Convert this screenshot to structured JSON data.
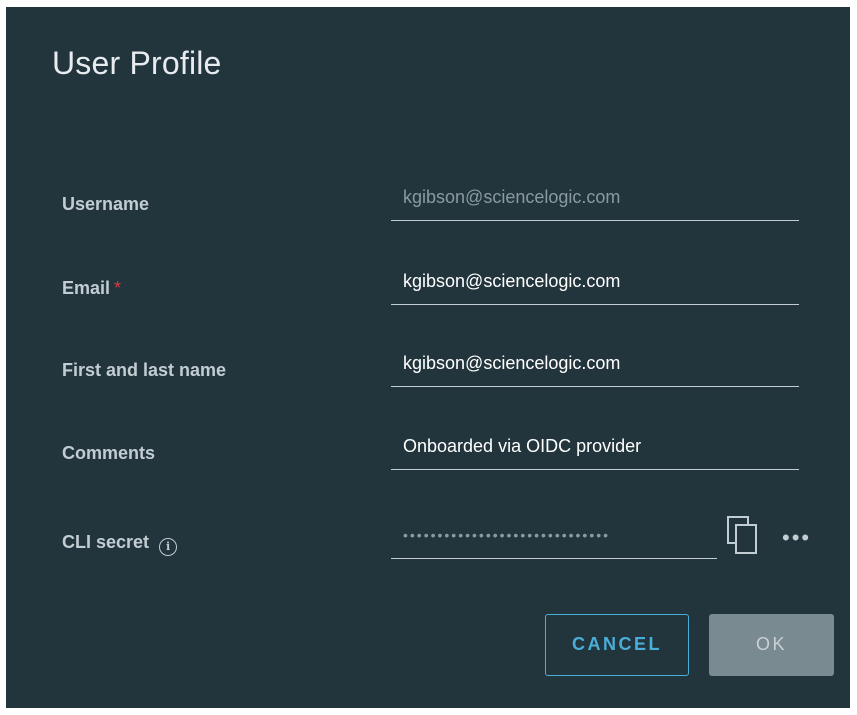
{
  "dialog": {
    "title": "User Profile"
  },
  "fields": {
    "username": {
      "label": "Username",
      "value": "kgibson@sciencelogic.com"
    },
    "email": {
      "label": "Email",
      "required_marker": "*",
      "value": "kgibson@sciencelogic.com"
    },
    "full_name": {
      "label": "First and last name",
      "value": "kgibson@sciencelogic.com"
    },
    "comments": {
      "label": "Comments",
      "value": "Onboarded via OIDC provider"
    },
    "cli_secret": {
      "label": "CLI secret",
      "info_glyph": "i",
      "masked_value": "••••••••••••••••••••••••••••••"
    }
  },
  "actions": {
    "cancel_label": "CANCEL",
    "ok_label": "OK",
    "more_glyph": "•••"
  },
  "icons": {
    "info": "info-icon",
    "copy": "copy-icon",
    "more": "more-options-icon"
  },
  "colors": {
    "background": "#22343c",
    "accent": "#49afd9",
    "required": "#e23a3a",
    "disabled_button": "#7a8a91"
  }
}
